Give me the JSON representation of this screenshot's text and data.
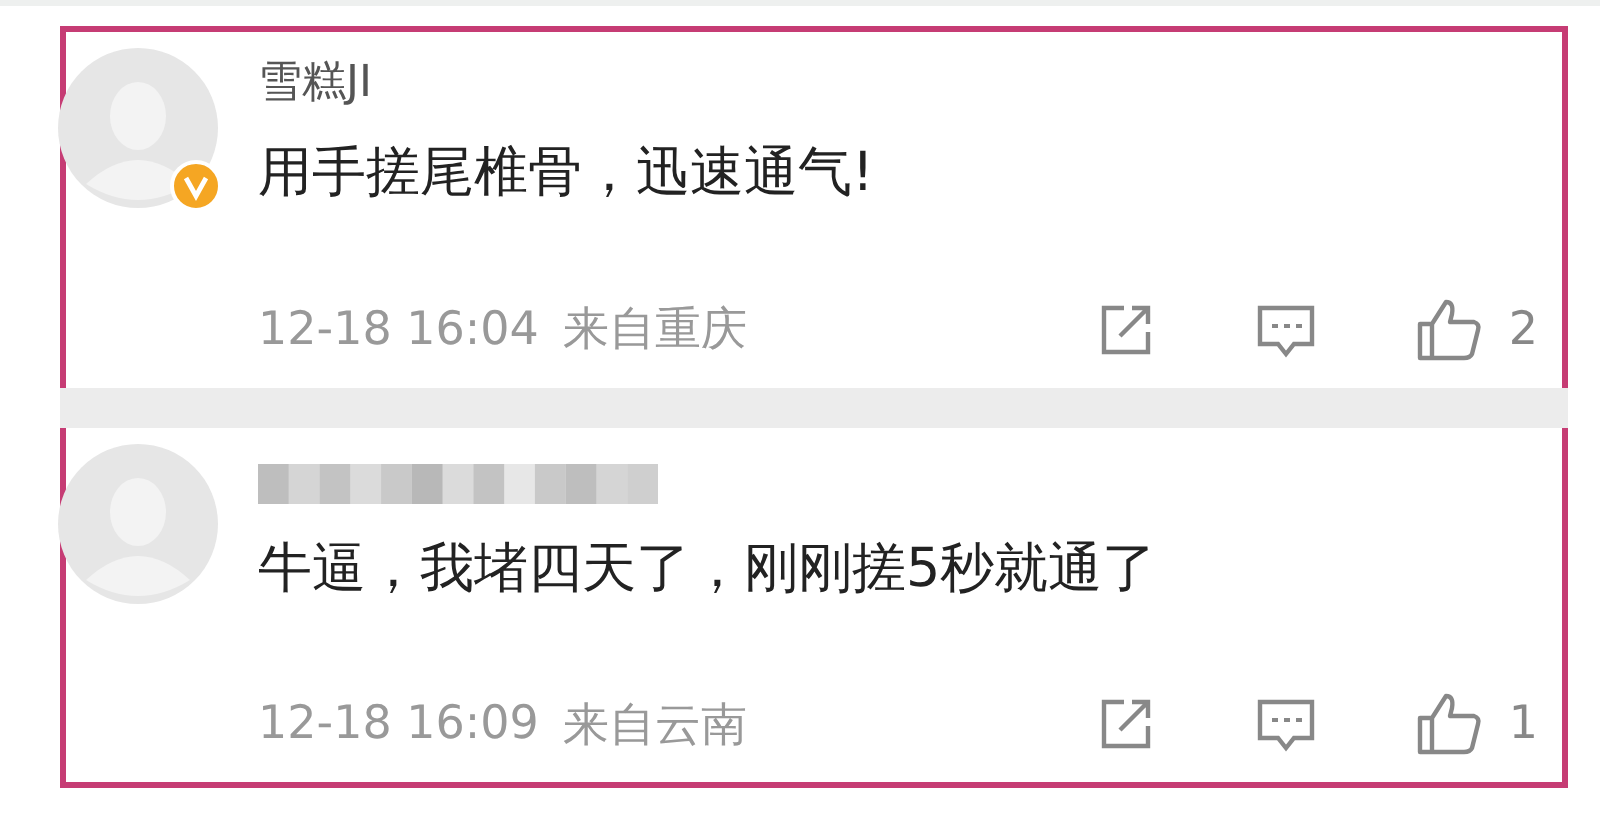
{
  "comments": [
    {
      "name": "雪糕JI",
      "name_blurred": false,
      "verified": true,
      "text": "用手搓尾椎骨，迅速通气!",
      "time": "12-18 16:04",
      "location": "来自重庆",
      "likes": "2"
    },
    {
      "name_blurred": true,
      "verified": false,
      "text": "牛逼，我堵四天了，刚刚搓5秒就通了",
      "time": "12-18 16:09",
      "location": "来自云南",
      "likes": "1"
    }
  ]
}
